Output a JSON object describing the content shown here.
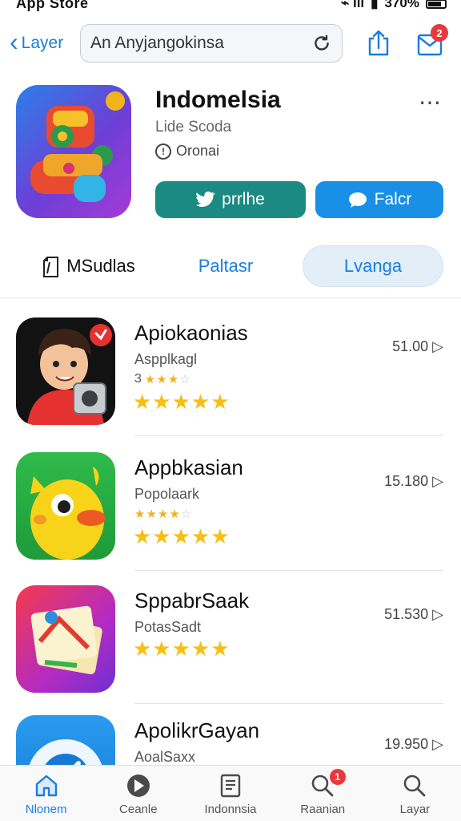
{
  "status_bar": {
    "app_label": "App Store",
    "battery": "370%"
  },
  "top_bar": {
    "back_label": "Layer",
    "search_value": "An Anyjangokinsa",
    "inbox_badge": "2"
  },
  "hero": {
    "title": "Indomelsia",
    "developer": "Lide Scoda",
    "age_rating": "Oronai",
    "primary_button": "prrlhe",
    "secondary_button": "Falcr"
  },
  "segments": [
    {
      "label": "MSudlas",
      "state": "default"
    },
    {
      "label": "Paltasr",
      "state": "link"
    },
    {
      "label": "Lvanga",
      "state": "selected"
    }
  ],
  "apps": [
    {
      "name": "Apiokaonias",
      "subtitle": "Aspplkagl",
      "small_rating": "3",
      "small_stars": 3,
      "stars": 5,
      "price": "51.00"
    },
    {
      "name": "Appbkasian",
      "subtitle": "Popolaark",
      "small_rating": "",
      "small_stars": 4,
      "stars": 5,
      "price": "15.180"
    },
    {
      "name": "SppabrSaak",
      "subtitle": "PotasSadt",
      "small_rating": "",
      "small_stars": 0,
      "stars": 5,
      "price": "51.530"
    },
    {
      "name": "ApolikrGayan",
      "subtitle": "AoalSaxx",
      "small_rating": "",
      "small_stars": 0,
      "stars": 0,
      "price": "19.950"
    }
  ],
  "tab_bar": {
    "tabs": [
      {
        "label": "Nlonem",
        "icon": "home-icon",
        "active": true
      },
      {
        "label": "Ceanle",
        "icon": "compass-icon",
        "active": false
      },
      {
        "label": "Indonnsia",
        "icon": "document-icon",
        "active": false
      },
      {
        "label": "Raanian",
        "icon": "search-icon",
        "active": false,
        "badge": "1"
      },
      {
        "label": "Layar",
        "icon": "search-icon",
        "active": false
      }
    ]
  },
  "colors": {
    "accent": "#1a7ddf",
    "primary_button": "#1b8a82",
    "secondary_button": "#1a8fe6",
    "badge": "#e8383b",
    "star": "#f6bf14"
  }
}
